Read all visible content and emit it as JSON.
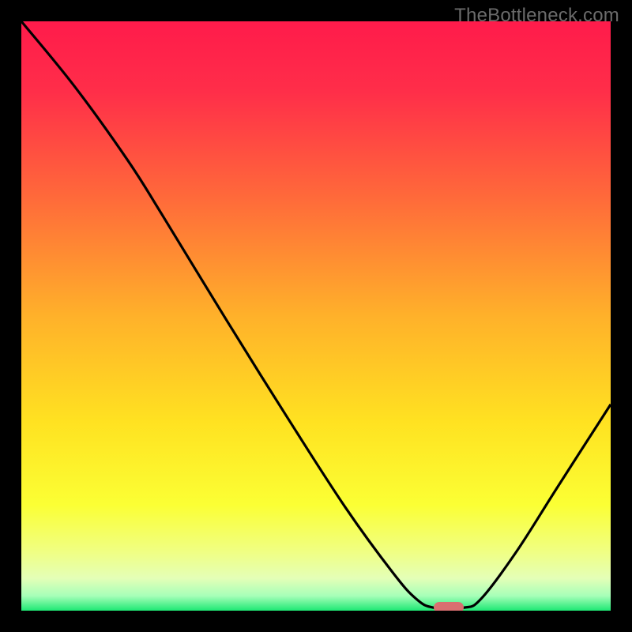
{
  "watermark": "TheBottleneck.com",
  "chart_data": {
    "type": "line",
    "title": "",
    "xlabel": "",
    "ylabel": "",
    "xlim": [
      0,
      100
    ],
    "ylim": [
      0,
      100
    ],
    "background_gradient": {
      "stops": [
        {
          "offset": 0.0,
          "color": "#ff1b4b"
        },
        {
          "offset": 0.12,
          "color": "#ff2e49"
        },
        {
          "offset": 0.3,
          "color": "#ff6a3a"
        },
        {
          "offset": 0.5,
          "color": "#ffb12a"
        },
        {
          "offset": 0.68,
          "color": "#ffe221"
        },
        {
          "offset": 0.82,
          "color": "#fbff34"
        },
        {
          "offset": 0.9,
          "color": "#f0ff83"
        },
        {
          "offset": 0.945,
          "color": "#e4ffb7"
        },
        {
          "offset": 0.975,
          "color": "#a6ffb8"
        },
        {
          "offset": 1.0,
          "color": "#1de874"
        }
      ]
    },
    "series": [
      {
        "name": "curve",
        "color": "#000000",
        "points": [
          {
            "x": 0.0,
            "y": 100.0
          },
          {
            "x": 9.0,
            "y": 89.0
          },
          {
            "x": 18.0,
            "y": 76.5
          },
          {
            "x": 24.0,
            "y": 67.0
          },
          {
            "x": 35.0,
            "y": 49.0
          },
          {
            "x": 45.0,
            "y": 33.0
          },
          {
            "x": 55.0,
            "y": 17.5
          },
          {
            "x": 63.0,
            "y": 6.5
          },
          {
            "x": 67.0,
            "y": 2.0
          },
          {
            "x": 70.0,
            "y": 0.5
          },
          {
            "x": 75.0,
            "y": 0.5
          },
          {
            "x": 78.0,
            "y": 2.0
          },
          {
            "x": 84.0,
            "y": 10.0
          },
          {
            "x": 91.0,
            "y": 21.0
          },
          {
            "x": 100.0,
            "y": 35.0
          }
        ]
      }
    ],
    "marker": {
      "x": 72.5,
      "y": 0.5,
      "color": "#d96f70"
    }
  }
}
